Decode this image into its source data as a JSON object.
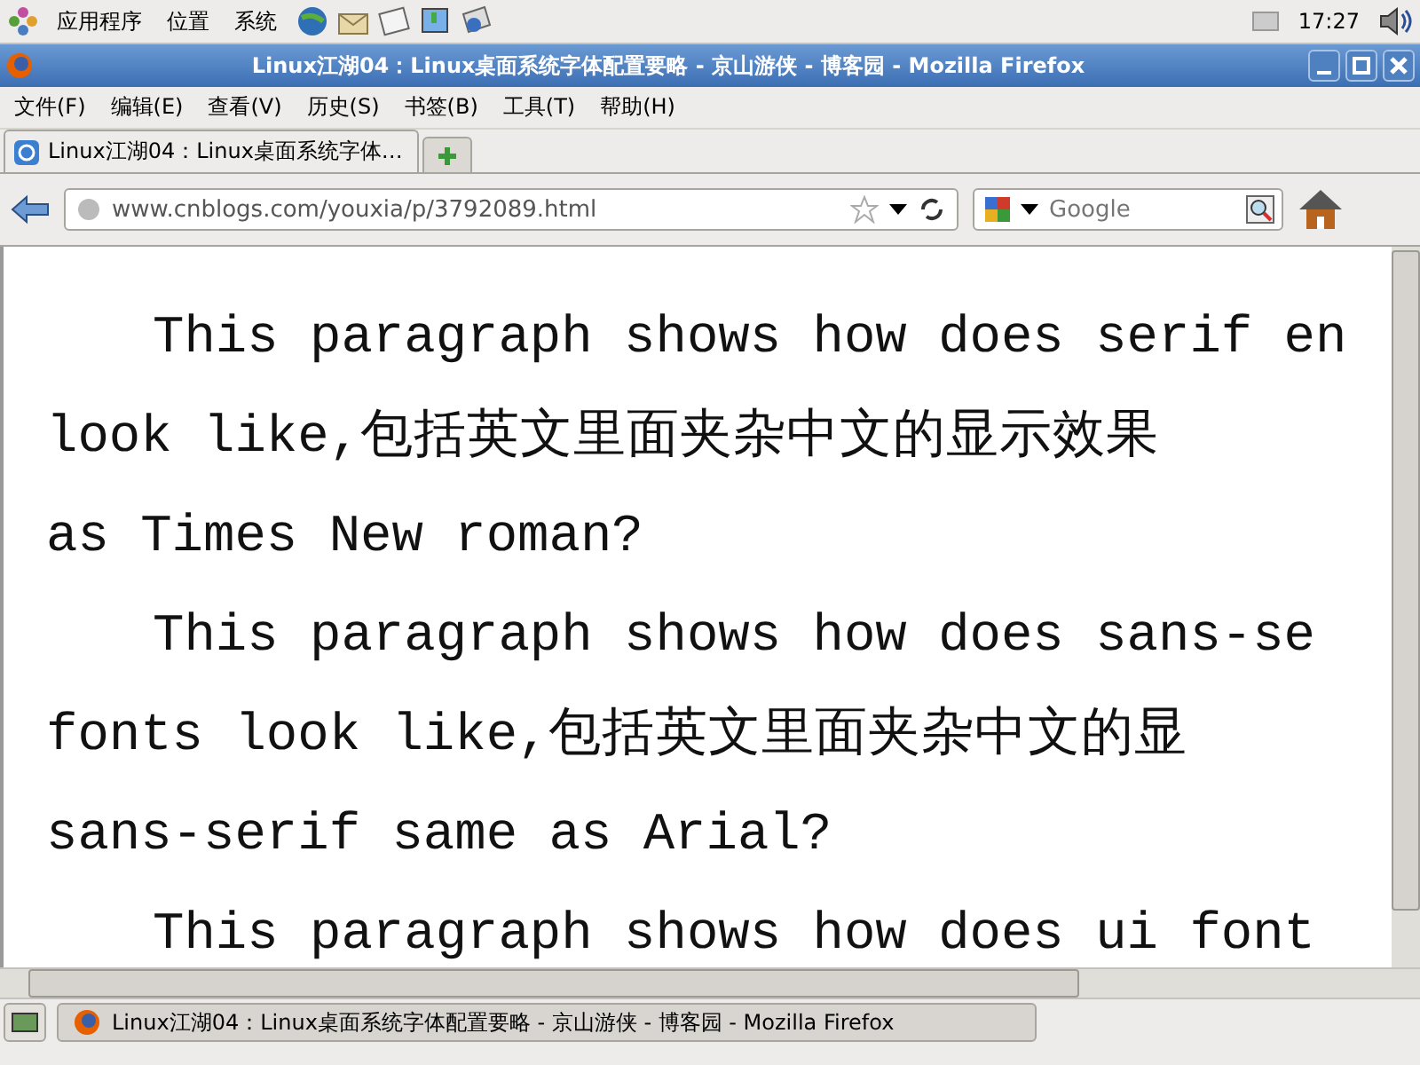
{
  "top_panel": {
    "menus": [
      "应用程序",
      "位置",
      "系统"
    ],
    "clock": "17:27"
  },
  "window": {
    "title": "Linux江湖04：Linux桌面系统字体配置要略 - 京山游侠 - 博客园 - Mozilla Firefox"
  },
  "menu_bar": [
    "文件(F)",
    "编辑(E)",
    "查看(V)",
    "历史(S)",
    "书签(B)",
    "工具(T)",
    "帮助(H)"
  ],
  "tabs": [
    {
      "label": "Linux江湖04：Linux桌面系统字体…",
      "selected": true
    }
  ],
  "address_bar": {
    "value": "www.cnblogs.com/youxia/p/3792089.html"
  },
  "search": {
    "placeholder": "Google"
  },
  "content": {
    "lines": [
      {
        "text": "This paragraph shows how does serif en",
        "indent": true
      },
      {
        "text": "look like,包括英文里面夹杂中文的显示效果",
        "indent": false
      },
      {
        "text": "as Times New roman?",
        "indent": false
      },
      {
        "text": "This paragraph shows how does sans-se",
        "indent": true
      },
      {
        "text": "fonts look like,包括英文里面夹杂中文的显",
        "indent": false
      },
      {
        "text": "sans-serif same as Arial?",
        "indent": false
      },
      {
        "text": "This paragraph shows how does ui font",
        "indent": true
      }
    ]
  },
  "taskbar": {
    "windows": [
      {
        "label": "Linux江湖04：Linux桌面系统字体配置要略 - 京山游侠 - 博客园 - Mozilla Firefox",
        "selected": true
      }
    ]
  }
}
